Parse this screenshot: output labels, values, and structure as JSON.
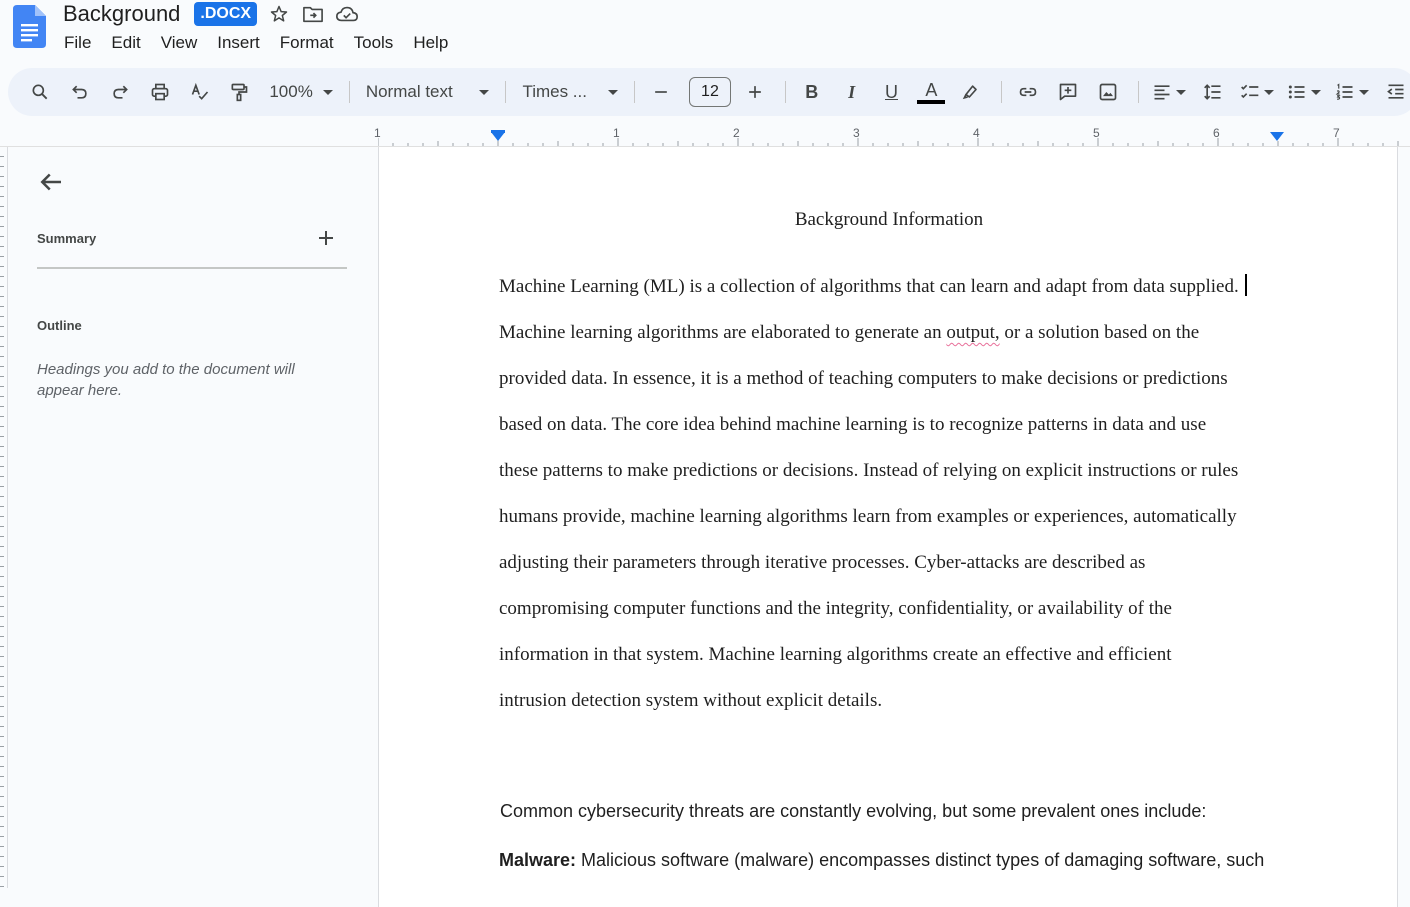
{
  "header": {
    "title": "Background",
    "badge": ".DOCX",
    "icons": [
      "star-icon",
      "move-folder-icon",
      "cloud-status-icon"
    ],
    "menu": [
      "File",
      "Edit",
      "View",
      "Insert",
      "Format",
      "Tools",
      "Help"
    ]
  },
  "toolbar": {
    "zoom": "100%",
    "style": "Normal text",
    "font": "Times ...",
    "font_size": "12",
    "bold_label": "B",
    "italic_label": "I",
    "underline_label": "U",
    "text_color_label": "A",
    "minus": "–",
    "plus": "+"
  },
  "ruler": {
    "numbers": [
      "1",
      "1",
      "2",
      "3",
      "4",
      "5",
      "6",
      "7"
    ]
  },
  "sidebar": {
    "summary_label": "Summary",
    "outline_label": "Outline",
    "outline_hint": "Headings you add to the document will appear here."
  },
  "document": {
    "title": "Background Information",
    "paragraph1": [
      "Machine Learning (ML) is a collection of algorithms that can learn and adapt from data supplied.",
      "Machine learning algorithms are elaborated to generate an ",
      "output,",
      " or a solution based on the",
      "provided data. In essence, it is a method of teaching computers to make decisions or predictions",
      "based on data. The core idea behind machine learning is to recognize patterns in data and use",
      "these patterns to make predictions or decisions. Instead of relying on explicit instructions or rules",
      "humans provide, machine learning algorithms learn from examples or experiences, automatically",
      "adjusting their parameters through iterative processes. Cyber-attacks are described as",
      "compromising computer functions and the integrity, confidentiality, or availability of the",
      "information in that system. Machine learning algorithms create an effective and efficient",
      "intrusion detection system without explicit details."
    ],
    "paragraph2": "Common cybersecurity threats are constantly evolving, but some prevalent ones include:",
    "paragraph3_bold": "Malware:",
    "paragraph3_rest": " Malicious software (malware) encompasses distinct types of damaging software, such"
  },
  "colors": {
    "accent": "#1a73e8",
    "toolbar_bg": "#edf2fa",
    "spellcheck": "#e8709a"
  }
}
